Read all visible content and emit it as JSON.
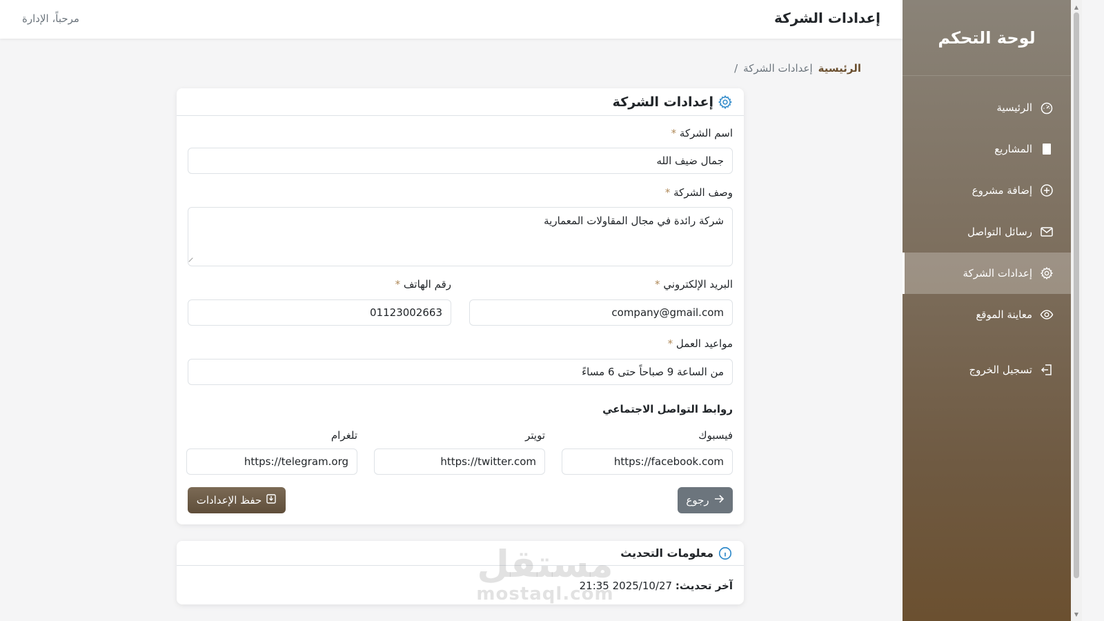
{
  "topbar": {
    "title": "إعدادات الشركة",
    "welcome": "مرحباً، الإدارة"
  },
  "breadcrumb": {
    "home": "الرئيسية",
    "current": "إعدادات الشركة",
    "separator": "/"
  },
  "sidebar": {
    "title": "لوحة التحكم",
    "items": [
      {
        "label": "الرئيسية",
        "icon": "speedometer-icon"
      },
      {
        "label": "المشاريع",
        "icon": "file-icon"
      },
      {
        "label": "إضافة مشروع",
        "icon": "plus-circle-icon"
      },
      {
        "label": "رسائل التواصل",
        "icon": "envelope-icon"
      },
      {
        "label": "إعدادات الشركة",
        "icon": "gear-icon",
        "active": true
      },
      {
        "label": "معاينة الموقع",
        "icon": "eye-icon"
      },
      {
        "label": "تسجيل الخروج",
        "icon": "logout-icon"
      }
    ]
  },
  "form": {
    "header": "إعدادات الشركة",
    "required_mark": "*",
    "company_name": {
      "label": "اسم الشركة",
      "value": "جمال ضيف الله"
    },
    "company_desc": {
      "label": "وصف الشركة",
      "value": "شركة رائدة في مجال المقاولات المعمارية"
    },
    "email": {
      "label": "البريد الإلكتروني",
      "value": "company@gmail.com"
    },
    "phone": {
      "label": "رقم الهاتف",
      "value": "01123002663"
    },
    "hours": {
      "label": "مواعيد العمل",
      "value": "من الساعة 9 صباحاً حتى 6 مساءً"
    },
    "social_title": "روابط التواصل الاجتماعي",
    "facebook": {
      "label": "فيسبوك",
      "value": "https://facebook.com"
    },
    "twitter": {
      "label": "تويتر",
      "value": "https://twitter.com"
    },
    "telegram": {
      "label": "تلغرام",
      "value": "https://telegram.org"
    },
    "back_label": "رجوع",
    "save_label": "حفظ الإعدادات"
  },
  "update_info": {
    "header": "معلومات التحديث",
    "label": "آخر تحديث:",
    "value": "2025/10/27 21:35"
  },
  "watermark": {
    "arabic": "مستقل",
    "latin": "mostaql.com"
  },
  "colors": {
    "accent": "#6b5030",
    "info": "#2c88c9",
    "back_button": "#6c757d"
  }
}
